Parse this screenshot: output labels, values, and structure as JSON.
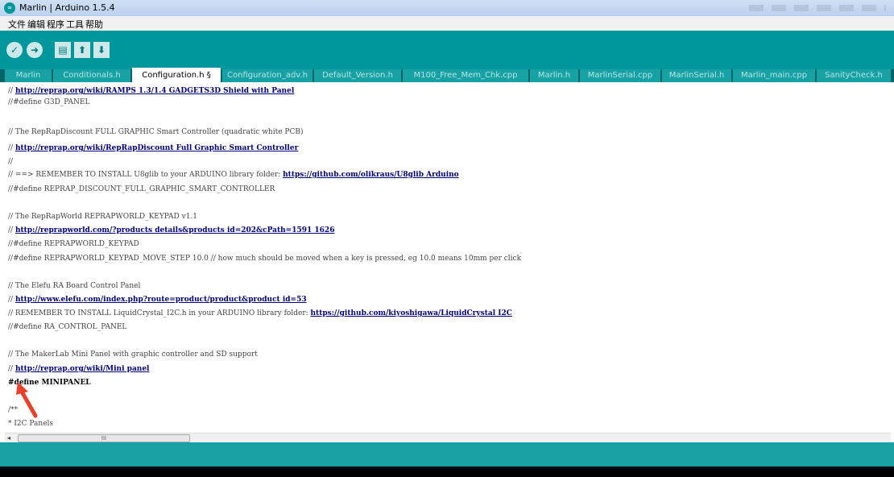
{
  "window": {
    "title": "Marlin | Arduino 1.5.4",
    "app_icon_glyph": "∞"
  },
  "menubar": {
    "items": [
      "文件",
      "编辑",
      "程序",
      "工具",
      "帮助"
    ]
  },
  "toolbar": {
    "buttons": [
      "verify-icon",
      "upload-icon",
      "new-icon",
      "open-icon",
      "save-icon"
    ],
    "accent": "#00979c"
  },
  "tabs": [
    {
      "label": "Marlin",
      "active": false
    },
    {
      "label": "Conditionals.h",
      "active": false
    },
    {
      "label": "Configuration.h §",
      "active": true
    },
    {
      "label": "Configuration_adv.h",
      "active": false
    },
    {
      "label": "Default_Version.h",
      "active": false
    },
    {
      "label": "M100_Free_Mem_Chk.cpp",
      "active": false
    },
    {
      "label": "Marlin.h",
      "active": false
    },
    {
      "label": "MarlinSerial.cpp",
      "active": false
    },
    {
      "label": "MarlinSerial.h",
      "active": false
    },
    {
      "label": "Marlin_main.cpp",
      "active": false
    },
    {
      "label": "SanityCheck.h",
      "active": false
    }
  ],
  "code_lines": [
    {
      "pre": "// ",
      "link": "http://reprap.org/wiki/RAMPS 1.3/1.4 GADGETS3D Shield with Panel",
      "post": ""
    },
    {
      "pre": "//#define G3D_PANEL",
      "link": "",
      "post": ""
    },
    {
      "pre": "",
      "link": "",
      "post": ""
    },
    {
      "pre": "// The RepRapDiscount FULL GRAPHIC Smart Controller (quadratic white PCB)",
      "link": "",
      "post": ""
    },
    {
      "pre": "// ",
      "link": "http://reprap.org/wiki/RepRapDiscount Full Graphic Smart Controller",
      "post": ""
    },
    {
      "pre": "//",
      "link": "",
      "post": ""
    },
    {
      "pre": "// ==> REMEMBER TO INSTALL U8glib to your ARDUINO library folder: ",
      "link": "https://github.com/olikraus/U8glib Arduino",
      "post": ""
    },
    {
      "pre": "//#define REPRAP_DISCOUNT_FULL_GRAPHIC_SMART_CONTROLLER",
      "link": "",
      "post": ""
    },
    {
      "pre": "",
      "link": "",
      "post": ""
    },
    {
      "pre": "// The RepRapWorld REPRAPWORLD_KEYPAD v1.1",
      "link": "",
      "post": ""
    },
    {
      "pre": "// ",
      "link": "http://reprapworld.com/?products details&products id=202&cPath=1591 1626",
      "post": ""
    },
    {
      "pre": "//#define REPRAPWORLD_KEYPAD",
      "link": "",
      "post": ""
    },
    {
      "pre": "//#define REPRAPWORLD_KEYPAD_MOVE_STEP 10.0 // how much should be moved when a key is pressed, eg 10.0 means 10mm per click",
      "link": "",
      "post": ""
    },
    {
      "pre": "",
      "link": "",
      "post": ""
    },
    {
      "pre": "// The Elefu RA Board Control Panel",
      "link": "",
      "post": ""
    },
    {
      "pre": "// ",
      "link": "http://www.elefu.com/index.php?route=product/product&product id=53",
      "post": ""
    },
    {
      "pre": "// REMEMBER TO INSTALL LiquidCrystal_I2C.h in your ARDUINO library folder: ",
      "link": "https://github.com/kiyoshigawa/LiquidCrystal I2C",
      "post": ""
    },
    {
      "pre": "//#define RA_CONTROL_PANEL",
      "link": "",
      "post": ""
    },
    {
      "pre": "",
      "link": "",
      "post": ""
    },
    {
      "pre": "// The MakerLab Mini Panel with graphic controller and SD support",
      "link": "",
      "post": ""
    },
    {
      "pre": "// ",
      "link": "http://reprap.org/wiki/Mini panel",
      "post": ""
    },
    {
      "pre": "#define MINIPANEL",
      "link": "",
      "post": "",
      "active": true
    },
    {
      "pre": "",
      "link": "",
      "post": ""
    },
    {
      "pre": "/**",
      "link": "",
      "post": ""
    },
    {
      "pre": " * I2C Panels",
      "link": "",
      "post": ""
    }
  ],
  "scrollbar": {
    "left_arrow": "◂",
    "thumb_grip": "III"
  },
  "annotation": {
    "arrow_color": "#e8402a",
    "target": "#define MINIPANEL"
  },
  "colors": {
    "teal": "#00979c",
    "tab_bg": "#006468",
    "status": "#17a1a5"
  }
}
